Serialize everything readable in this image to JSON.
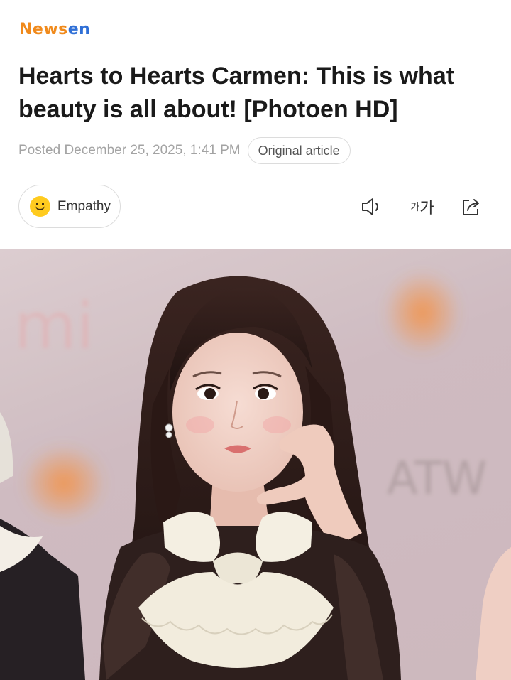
{
  "brand": {
    "logo_part1": "News",
    "logo_part2": "en"
  },
  "article": {
    "headline": "Hearts to Hearts Carmen: This is what beauty is all about! [Photoen HD]",
    "posted_label": "Posted",
    "posted_date": "December 25, 2025, 1:41 PM",
    "original_article_label": "Original article"
  },
  "actions": {
    "empathy_label": "Empathy",
    "font_small": "가",
    "font_big": "가"
  },
  "icons": {
    "speaker": "speaker-icon",
    "share": "share-icon",
    "empathy": "smiley-icon"
  },
  "colors": {
    "logo_orange": "#f08a1c",
    "logo_blue": "#2f6fd6",
    "smiley": "#ffcb1f"
  }
}
